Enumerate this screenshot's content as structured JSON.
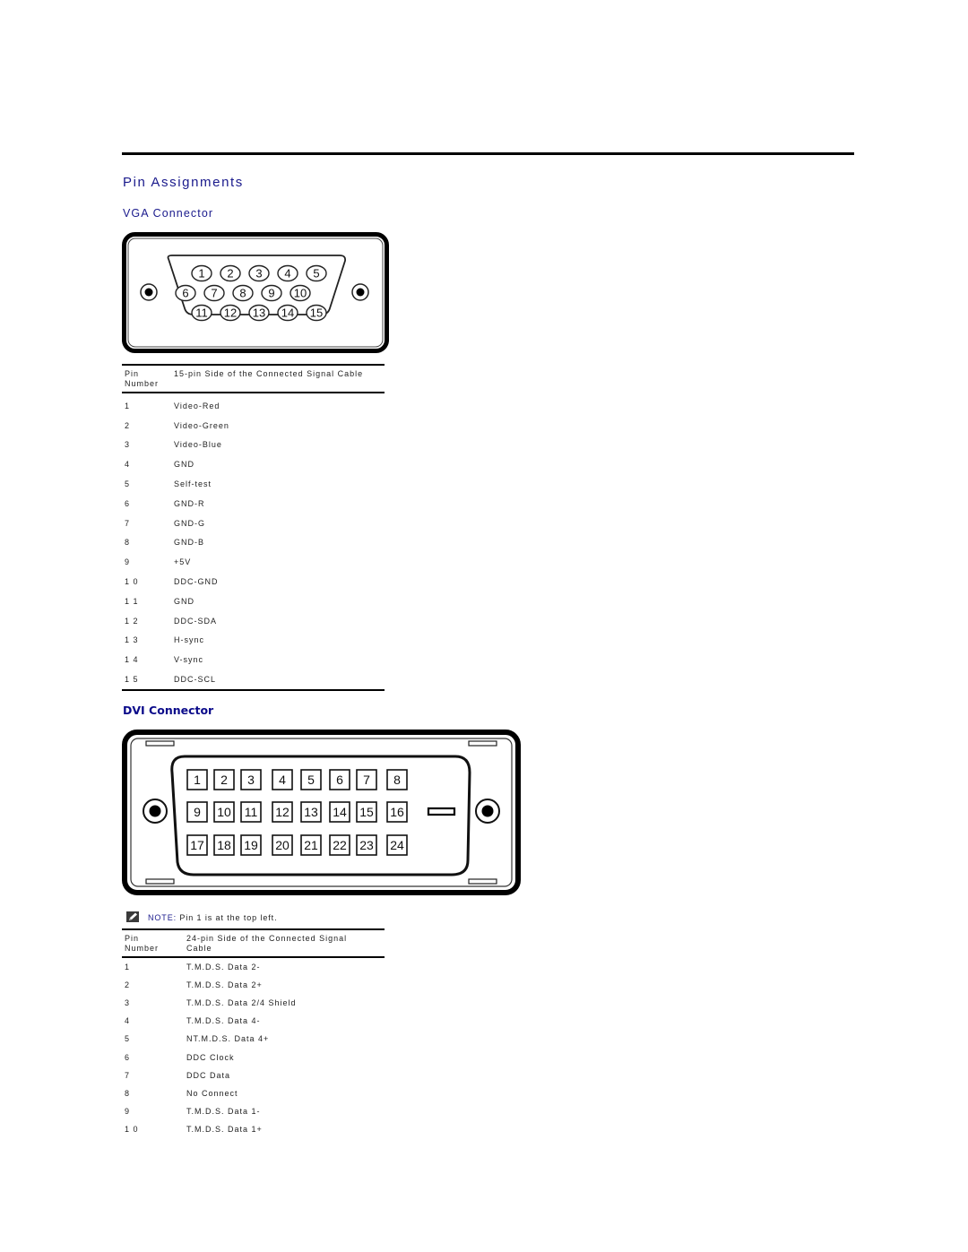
{
  "page": {
    "title": "Pin Assignments"
  },
  "vga": {
    "heading": "VGA Connector",
    "diagram": {
      "icon": "vga-connector-diagram",
      "rows": [
        [
          "1",
          "2",
          "3",
          "4",
          "5"
        ],
        [
          "6",
          "7",
          "8",
          "9",
          "10"
        ],
        [
          "11",
          "12",
          "13",
          "14",
          "15"
        ]
      ]
    },
    "table": {
      "headers": [
        "Pin Number",
        "15-pin Side of the Connected Signal Cable"
      ],
      "header_lines": [
        [
          "Pin",
          "Number"
        ],
        [
          "15-pin Side of the Connected Signal Cable"
        ]
      ],
      "rows": [
        [
          "1",
          "Video-Red"
        ],
        [
          "2",
          "Video-Green"
        ],
        [
          "3",
          "Video-Blue"
        ],
        [
          "4",
          "GND"
        ],
        [
          "5",
          "Self-test"
        ],
        [
          "6",
          "GND-R"
        ],
        [
          "7",
          "GND-G"
        ],
        [
          "8",
          "GND-B"
        ],
        [
          "9",
          "+5V"
        ],
        [
          "1 0",
          "DDC-GND"
        ],
        [
          "1 1",
          "GND"
        ],
        [
          "1 2",
          "DDC-SDA"
        ],
        [
          "1 3",
          "H-sync"
        ],
        [
          "1 4",
          "V-sync"
        ],
        [
          "1 5",
          "DDC-SCL"
        ]
      ]
    }
  },
  "dvi": {
    "heading": "DVI Connector",
    "diagram": {
      "icon": "dvi-connector-diagram",
      "rows": [
        [
          "1",
          "2",
          "3",
          "4",
          "5",
          "6",
          "7",
          "8"
        ],
        [
          "9",
          "10",
          "11",
          "12",
          "13",
          "14",
          "15",
          "16"
        ],
        [
          "17",
          "18",
          "19",
          "20",
          "21",
          "22",
          "23",
          "24"
        ]
      ]
    },
    "note": {
      "icon": "note-pencil-icon",
      "label": "NOTE:",
      "text": " Pin 1 is at the top left."
    },
    "table": {
      "headers": [
        "Pin Number",
        "24-pin Side of the Connected Signal Cable"
      ],
      "header_lines": [
        [
          "Pin",
          "Number"
        ],
        [
          "24-pin Side of the Connected Signal",
          "Cable"
        ]
      ],
      "rows": [
        [
          "1",
          "T.M.D.S. Data 2-"
        ],
        [
          "2",
          "T.M.D.S. Data 2+"
        ],
        [
          "3",
          "T.M.D.S. Data 2/4 Shield"
        ],
        [
          "4",
          "T.M.D.S. Data 4-"
        ],
        [
          "5",
          "NT.M.D.S. Data 4+"
        ],
        [
          "6",
          "DDC Clock"
        ],
        [
          "7",
          "DDC Data"
        ],
        [
          "8",
          "No Connect"
        ],
        [
          "9",
          "T.M.D.S. Data 1-"
        ],
        [
          "1 0",
          "T.M.D.S. Data 1+"
        ]
      ]
    }
  },
  "colors": {
    "heading": "#1a1a8c",
    "dvi_heading": "#0a0a8a",
    "rule": "#000000"
  }
}
